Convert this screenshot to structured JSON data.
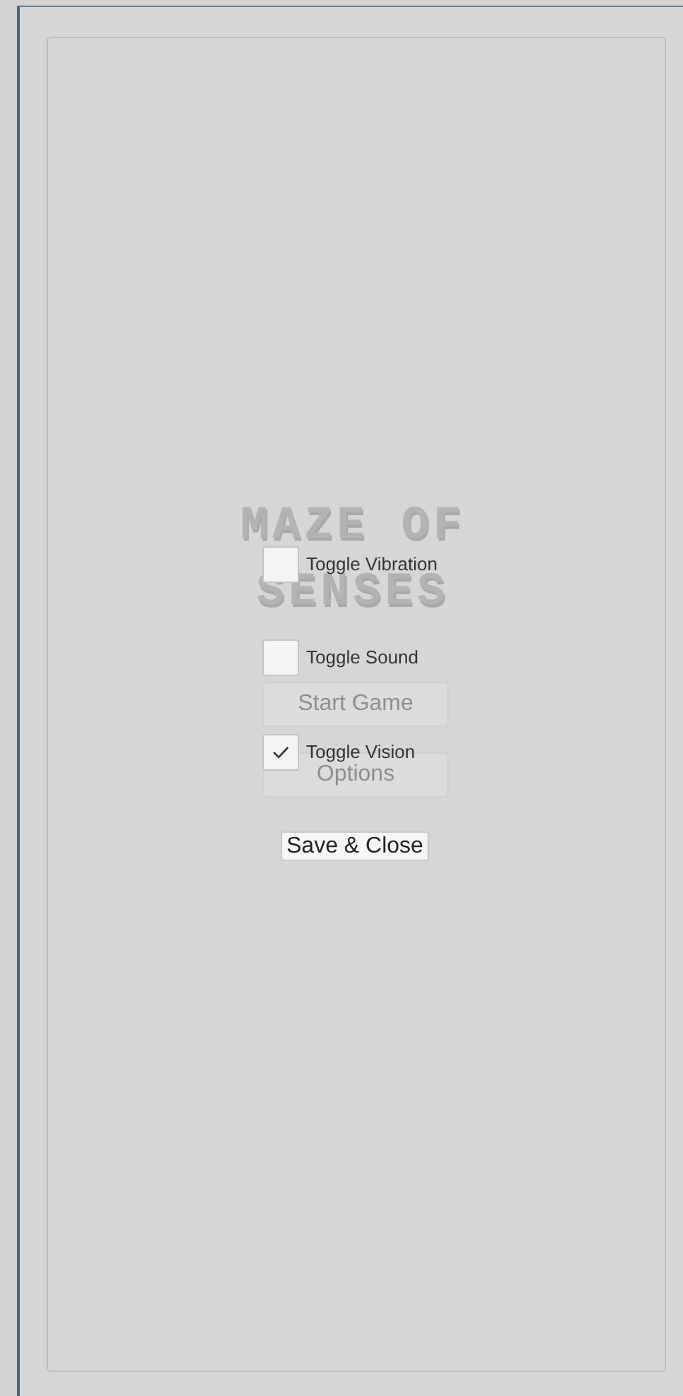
{
  "menu": {
    "title_lines": [
      "MAZE OF",
      "SENSES"
    ],
    "buttons": [
      {
        "label": "Start Game"
      },
      {
        "label": "Options"
      }
    ]
  },
  "options": {
    "toggles": [
      {
        "label": "Toggle Vibration",
        "checked": false
      },
      {
        "label": "Toggle Sound",
        "checked": false
      },
      {
        "label": "Toggle Vision",
        "checked": true
      }
    ],
    "save_button": "Save & Close"
  }
}
